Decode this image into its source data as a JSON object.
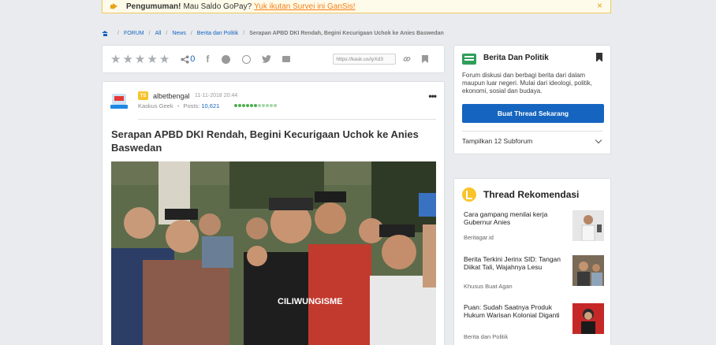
{
  "announcement": {
    "label": "Pengumuman!",
    "text": "Mau Saldo GoPay?",
    "link": "Yuk ikutan Survei ini GanSis!",
    "close": "×"
  },
  "breadcrumb": {
    "items": [
      "FORUM",
      "All",
      "News",
      "Berita dan Politik"
    ],
    "current": "Serapan APBD DKI Rendah, Begini Kecurigaan Uchok ke Anies Baswedan"
  },
  "toolbar": {
    "share_count": "0",
    "short_url": "https://kask.us/iyXd3"
  },
  "post": {
    "badge": "TS",
    "username": "albetbengal",
    "date": "11-11-2018 20:44",
    "rank": "Kaskus Geek",
    "posts_label": "Posts:",
    "posts_value": "10,621",
    "more": "•••",
    "title": "Serapan APBD DKI Rendah, Begini Kecurigaan Uchok ke Anies Baswedan",
    "shirt_text": "CILIWUNGISME"
  },
  "sidebar": {
    "category_title": "Berita Dan Politik",
    "category_desc": "Forum diskusi dan berbagi berita dari dalam maupun luar negeri. Mulai dari ideologi, politik, ekonomi, sosial dan budaya.",
    "create_button": "Buat Thread Sekarang",
    "subforum_label": "Tampilkan 12 Subforum",
    "recommend_title": "Thread Rekomendasi",
    "recommendations": [
      {
        "title": "Cara gampang menilai kerja Gubernur Anies",
        "source": "Beritagar.id"
      },
      {
        "title": "Berita Terkini Jerinx SID: Tangan Diikat Tali, Wajahnya Lesu",
        "source": "Khusus Buat Agan"
      },
      {
        "title": "Puan: Sudah Saatnya Produk Hukum Warisan Kolonial Diganti",
        "source": "Berita dan Politik"
      }
    ]
  }
}
